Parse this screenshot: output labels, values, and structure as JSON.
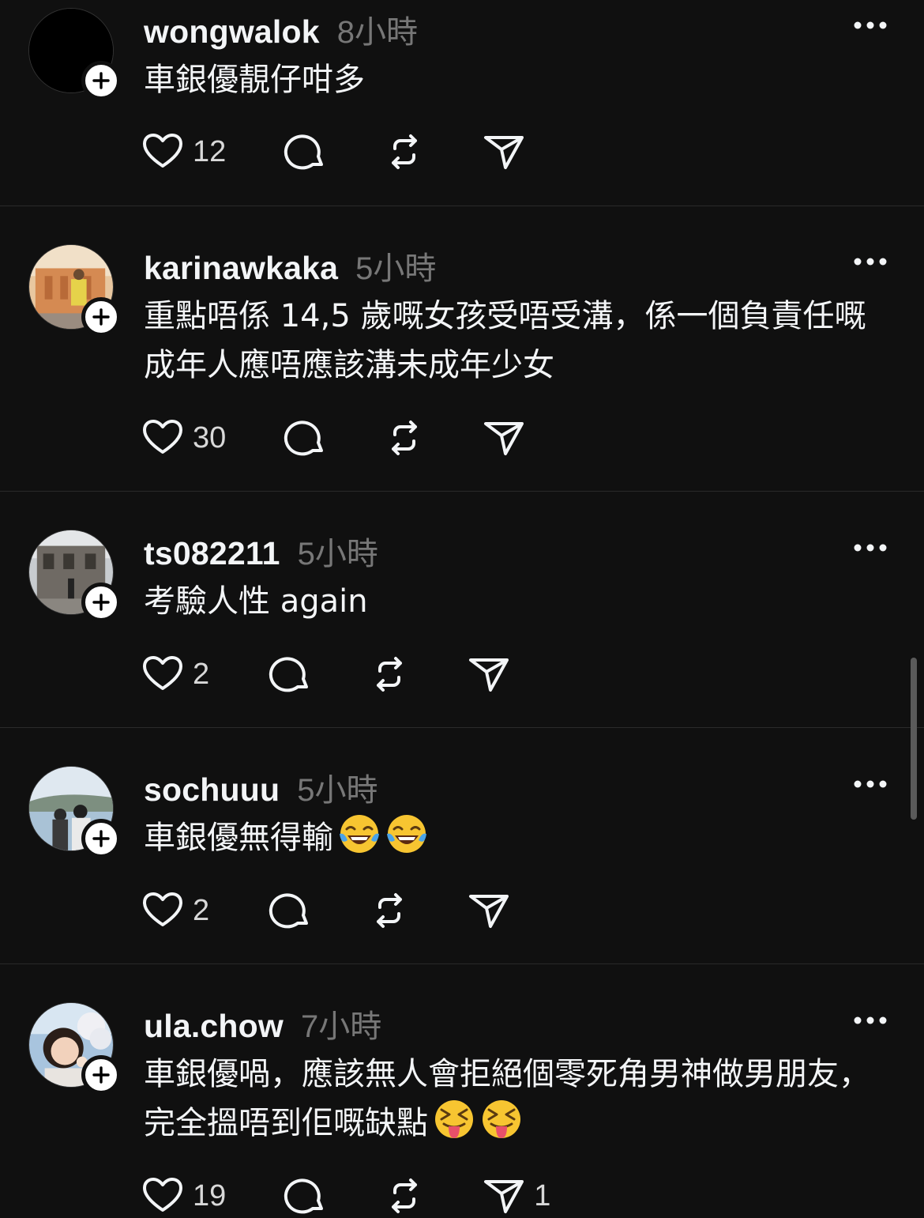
{
  "posts": [
    {
      "username": "wongwalok",
      "time": "8小時",
      "text": "車銀優靚仔咁多",
      "emojis": [],
      "likes": "12",
      "shares": ""
    },
    {
      "username": "karinawkaka",
      "time": "5小時",
      "text": "重點唔係 14,5 歲嘅女孩受唔受溝，係一個負責任嘅成年人應唔應該溝未成年少女",
      "emojis": [],
      "likes": "30",
      "shares": ""
    },
    {
      "username": "ts082211",
      "time": "5小時",
      "text": "考驗人性 again",
      "emojis": [],
      "likes": "2",
      "shares": ""
    },
    {
      "username": "sochuuu",
      "time": "5小時",
      "text": "車銀優無得輸",
      "emojis": [
        "face-with-tears-of-joy",
        "face-with-tears-of-joy"
      ],
      "likes": "2",
      "shares": ""
    },
    {
      "username": "ula.chow",
      "time": "7小時",
      "text": "車銀優喎，應該無人會拒絕個零死角男神做男朋友，完全搵唔到佢嘅缺點",
      "emojis": [
        "squinting-face-with-tongue",
        "squinting-face-with-tongue"
      ],
      "likes": "19",
      "shares": "1"
    }
  ],
  "icons": {
    "like": "heart-icon",
    "reply": "comment-bubble-icon",
    "repost": "repost-icon",
    "share": "send-icon",
    "more": "more-dots-icon",
    "follow": "plus-icon"
  },
  "colors": {
    "background": "#101010",
    "text": "#f3f5f7",
    "secondary": "#777777",
    "divider": "#2a2a2a"
  }
}
